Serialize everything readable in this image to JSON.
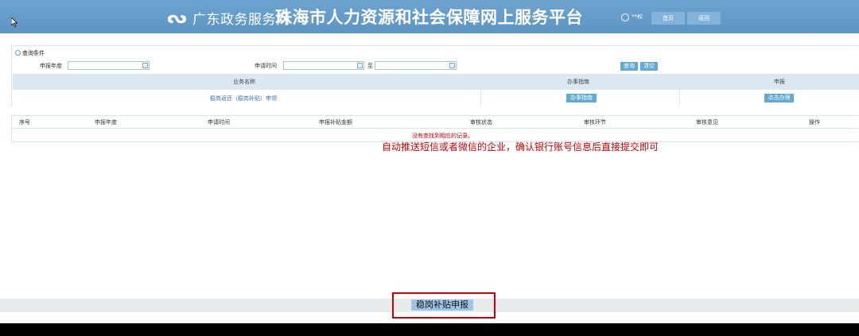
{
  "header": {
    "logo_glyph": "ᔓ",
    "portal_name": "广东政务服务网",
    "site_title": "珠海市人力资源和社会保障网上服务平台",
    "user_name": "**权",
    "home_label": "首页",
    "back_label": "返回"
  },
  "query": {
    "title": "查询条件",
    "year_label": "申报年度",
    "date_label": "申请时间",
    "to_label": "至",
    "year_value": "",
    "date_from_value": "",
    "date_to_value": "",
    "search_label": "查询",
    "clear_label": "清空"
  },
  "service_table": {
    "headers": [
      "业务名称",
      "办事指南",
      "申报"
    ],
    "row": {
      "name": "稳岗返还（稳岗补贴）申领",
      "guide_button": "办事指南",
      "apply_button": "点击办理"
    }
  },
  "result_table": {
    "columns": [
      "序号",
      "申报年度",
      "申请时间",
      "申报补贴金额",
      "审核状态",
      "审核环节",
      "审核意见",
      "操作"
    ],
    "empty_message": "没有查找到相应的记录。"
  },
  "annotation": "自动推送短信或者微信的企业，确认银行账号信息后直接提交即可",
  "footer": {
    "submit_label": "稳岗补贴申报"
  },
  "colors": {
    "header": "#5d95c4",
    "button": "#5fa9d3",
    "annotation": "#d60000",
    "highlight_border": "#d40000"
  }
}
